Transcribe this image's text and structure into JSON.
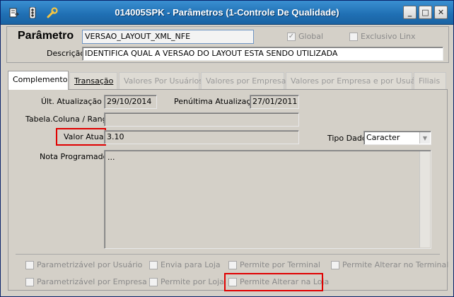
{
  "window": {
    "title": "014005SPK - Parâmetros (1-Controle De Qualidade)",
    "icons": [
      "document-arrow-icon",
      "traffic-light-icon",
      "wrench-icon"
    ],
    "buttons": {
      "minimize": "_",
      "maximize": "□",
      "close": "✕"
    }
  },
  "header": {
    "param_label": "Parâmetro",
    "param_value": "VERSAO_LAYOUT_XML_NFE",
    "global_label": "Global",
    "global_checked": true,
    "exclusivo_label": "Exclusivo Linx",
    "exclusivo_checked": false,
    "descricao_label": "Descrição",
    "descricao_value": "IDENTIFICA QUAL A VERSAO DO LAYOUT ESTA SENDO UTILIZADA"
  },
  "tabs": [
    {
      "label": "Complemento",
      "state": "active"
    },
    {
      "label": "Transação",
      "state": "enabled"
    },
    {
      "label": "Valores Por Usuários",
      "state": "disabled"
    },
    {
      "label": "Valores por Empresa",
      "state": "disabled"
    },
    {
      "label": "Valores por Empresa e por Usuário",
      "state": "disabled"
    },
    {
      "label": "Filiais",
      "state": "disabled"
    }
  ],
  "complemento": {
    "ult_atualizacao_label": "Últ. Atualização",
    "ult_atualizacao_value": "29/10/2014",
    "penultima_label": "Penúltima Atualização",
    "penultima_value": "27/01/2011",
    "tabela_label": "Tabela.Coluna / Range",
    "tabela_value": "",
    "valor_atual_label": "Valor Atual",
    "valor_atual_value": "3.10",
    "tipo_dado_label": "Tipo Dado",
    "tipo_dado_value": "Caracter",
    "nota_label": "Nota Programador",
    "nota_value": "..."
  },
  "options": {
    "row1": [
      "Parametrizável por Usuário",
      "Envia para Loja",
      "Permite por Terminal",
      "Permite Alterar no Terminal"
    ],
    "row2": [
      "Parametrizável por Empresa",
      "Permite por Loja",
      "Permite Alterar na Loja"
    ]
  },
  "highlight_color": "#e00000"
}
